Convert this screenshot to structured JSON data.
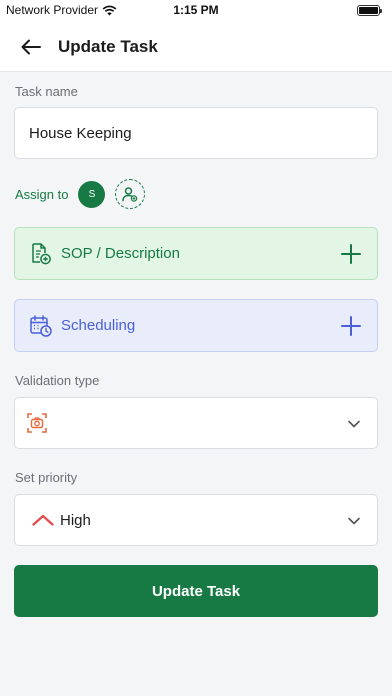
{
  "status_bar": {
    "carrier": "Network Provider",
    "time": "1:15 PM"
  },
  "header": {
    "title": "Update Task",
    "back_icon": "arrow-left-icon"
  },
  "task_name": {
    "label": "Task name",
    "value": "House Keeping"
  },
  "assign": {
    "label": "Assign to",
    "avatar_initial": "S",
    "add_icon": "add-user-icon"
  },
  "sop_card": {
    "label": "SOP / Description",
    "icon": "document-add-icon"
  },
  "scheduling_card": {
    "label": "Scheduling",
    "icon": "calendar-clock-icon"
  },
  "validation": {
    "label": "Validation type",
    "selected_icon": "camera-scan-icon"
  },
  "priority": {
    "label": "Set priority",
    "value": "High",
    "icon": "chevron-up-icon"
  },
  "submit": {
    "label": "Update Task"
  },
  "colors": {
    "primary_green": "#177a44",
    "sop_bg": "#e3f6e6",
    "scheduling_bg": "#e8ecfb",
    "scheduling_accent": "#4b60d6",
    "priority_high": "#e5484d",
    "validation_icon": "#e8693a"
  }
}
